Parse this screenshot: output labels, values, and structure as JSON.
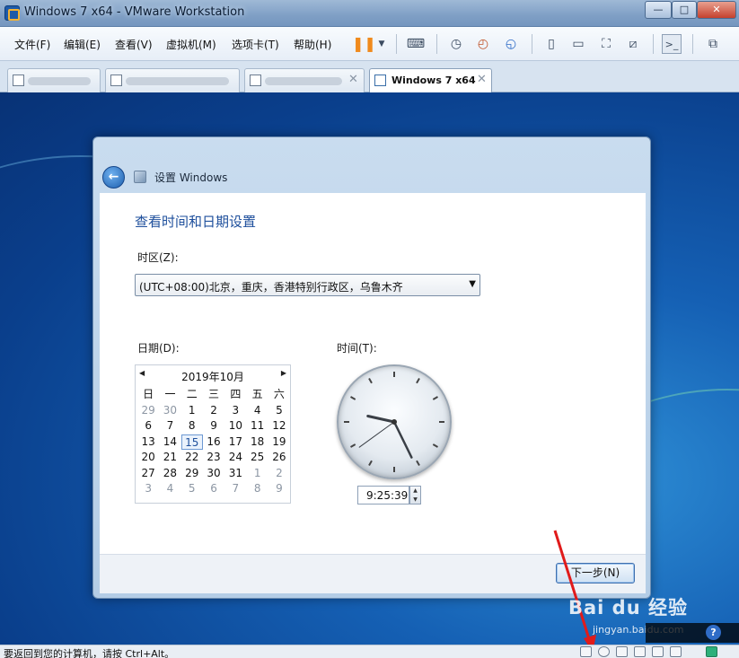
{
  "window": {
    "title": "Windows 7 x64 - VMware Workstation",
    "minimize": "—",
    "maximize": "□",
    "close": "✕"
  },
  "menu": {
    "items": [
      "文件(F)",
      "编辑(E)",
      "查看(V)",
      "虚拟机(M)",
      "选项卡(T)",
      "帮助(H)"
    ]
  },
  "tabs": {
    "active_label": "Windows 7 x64",
    "close_glyph": "✕"
  },
  "setup": {
    "title": "设置 Windows",
    "heading": "查看时间和日期设置",
    "timezone_label": "时区(Z):",
    "timezone_value": "(UTC+08:00)北京，重庆，香港特别行政区，乌鲁木齐",
    "date_label": "日期(D):",
    "time_label": "时间(T):",
    "calendar": {
      "month": "2019年10月",
      "weekdays": [
        "日",
        "一",
        "二",
        "三",
        "四",
        "五",
        "六"
      ],
      "days": [
        [
          "29",
          "30",
          "1",
          "2",
          "3",
          "4",
          "5"
        ],
        [
          "6",
          "7",
          "8",
          "9",
          "10",
          "11",
          "12"
        ],
        [
          "13",
          "14",
          "15",
          "16",
          "17",
          "18",
          "19"
        ],
        [
          "20",
          "21",
          "22",
          "23",
          "24",
          "25",
          "26"
        ],
        [
          "27",
          "28",
          "29",
          "30",
          "31",
          "1",
          "2"
        ],
        [
          "3",
          "4",
          "5",
          "6",
          "7",
          "8",
          "9"
        ]
      ],
      "selected_day": "15"
    },
    "clock": {
      "hours": 9,
      "minutes": 25,
      "seconds": 39
    },
    "time_value": "9:25:39",
    "next_button": "下一步(N)"
  },
  "watermark": {
    "text": "Bai du 经验",
    "sub": "jingyan.baidu.com"
  },
  "statusbar": {
    "text": "要返回到您的计算机，请按 Ctrl+Alt。"
  },
  "colors": {
    "accent": "#1e4f9c",
    "annotation_arrow": "#e01b1b"
  }
}
